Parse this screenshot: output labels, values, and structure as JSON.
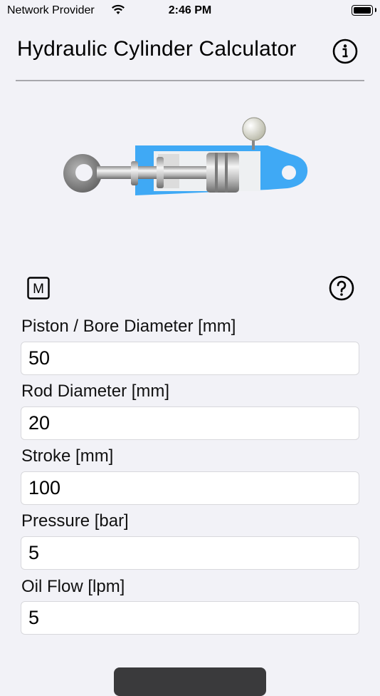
{
  "status_bar": {
    "carrier": "Network Provider",
    "time": "2:46 PM"
  },
  "header": {
    "title": "Hydraulic Cylinder Calculator",
    "info_icon": "info-circle-icon"
  },
  "toolbar": {
    "m_button_label": "M",
    "help_icon": "question-circle-icon"
  },
  "fields": [
    {
      "label": "Piston / Bore Diameter [mm]",
      "value": "50"
    },
    {
      "label": "Rod Diameter  [mm]",
      "value": "20"
    },
    {
      "label": "Stroke [mm]",
      "value": "100"
    },
    {
      "label": "Pressure [bar]",
      "value": "5"
    },
    {
      "label": "Oil Flow [lpm]",
      "value": "5"
    }
  ],
  "colors": {
    "background": "#f2f2f7",
    "cylinder_blue": "#3fa9f5"
  }
}
